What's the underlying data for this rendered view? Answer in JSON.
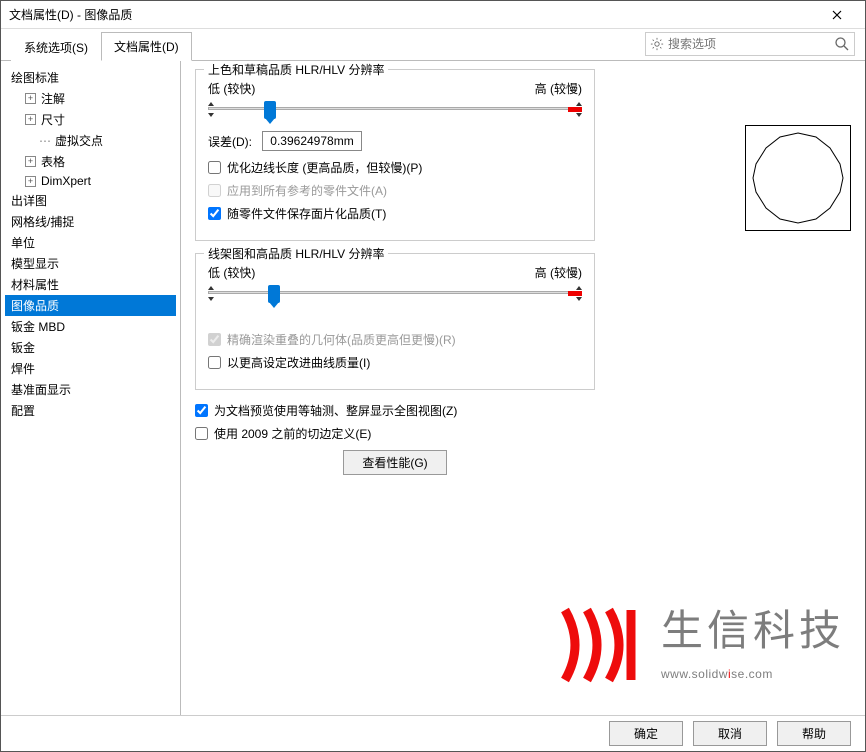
{
  "window": {
    "title": "文档属性(D) - 图像品质"
  },
  "tabs": {
    "system": "系统选项(S)",
    "doc": "文档属性(D)"
  },
  "search": {
    "placeholder": "搜索选项"
  },
  "tree": {
    "items": [
      {
        "label": "绘图标准",
        "indent": 0,
        "exp": ""
      },
      {
        "label": "注解",
        "indent": 1,
        "exp": "+"
      },
      {
        "label": "尺寸",
        "indent": 1,
        "exp": "+"
      },
      {
        "label": "虚拟交点",
        "indent": 2,
        "exp": ""
      },
      {
        "label": "表格",
        "indent": 1,
        "exp": "+"
      },
      {
        "label": "DimXpert",
        "indent": 1,
        "exp": "+"
      },
      {
        "label": "出详图",
        "indent": 0,
        "exp": ""
      },
      {
        "label": "网格线/捕捉",
        "indent": 0,
        "exp": ""
      },
      {
        "label": "单位",
        "indent": 0,
        "exp": ""
      },
      {
        "label": "模型显示",
        "indent": 0,
        "exp": ""
      },
      {
        "label": "材料属性",
        "indent": 0,
        "exp": ""
      },
      {
        "label": "图像品质",
        "indent": 0,
        "exp": "",
        "selected": true
      },
      {
        "label": "钣金 MBD",
        "indent": 0,
        "exp": ""
      },
      {
        "label": "钣金",
        "indent": 0,
        "exp": ""
      },
      {
        "label": "焊件",
        "indent": 0,
        "exp": ""
      },
      {
        "label": "基准面显示",
        "indent": 0,
        "exp": ""
      },
      {
        "label": "配置",
        "indent": 0,
        "exp": ""
      }
    ]
  },
  "group1": {
    "title": "上色和草稿品质 HLR/HLV 分辨率",
    "lowLabel": "低 (较快)",
    "highLabel": "高 (较慢)",
    "sliderPos": 15,
    "devLabel": "误差(D):",
    "devValue": "0.39624978mm",
    "opt1": "优化边线长度 (更高品质，但较慢)(P)",
    "opt2": "应用到所有参考的零件文件(A)",
    "opt3": "随零件文件保存面片化品质(T)"
  },
  "group2": {
    "title": "线架图和高品质 HLR/HLV 分辨率",
    "lowLabel": "低 (较快)",
    "highLabel": "高 (较慢)",
    "sliderPos": 16,
    "opt1": "精确渲染重叠的几何体(品质更高但更慢)(R)",
    "opt2": "以更高设定改进曲线质量(I)"
  },
  "bottomChecks": {
    "c1": "为文档预览使用等轴测、整屏显示全图视图(Z)",
    "c2": "使用 2009 之前的切边定义(E)"
  },
  "perfBtn": "查看性能(G)",
  "footer": {
    "ok": "确定",
    "cancel": "取消",
    "help": "帮助"
  },
  "watermark": {
    "cn": "生信科技",
    "url1": "www.solidw",
    "url2": "i",
    "url3": "se.com"
  }
}
